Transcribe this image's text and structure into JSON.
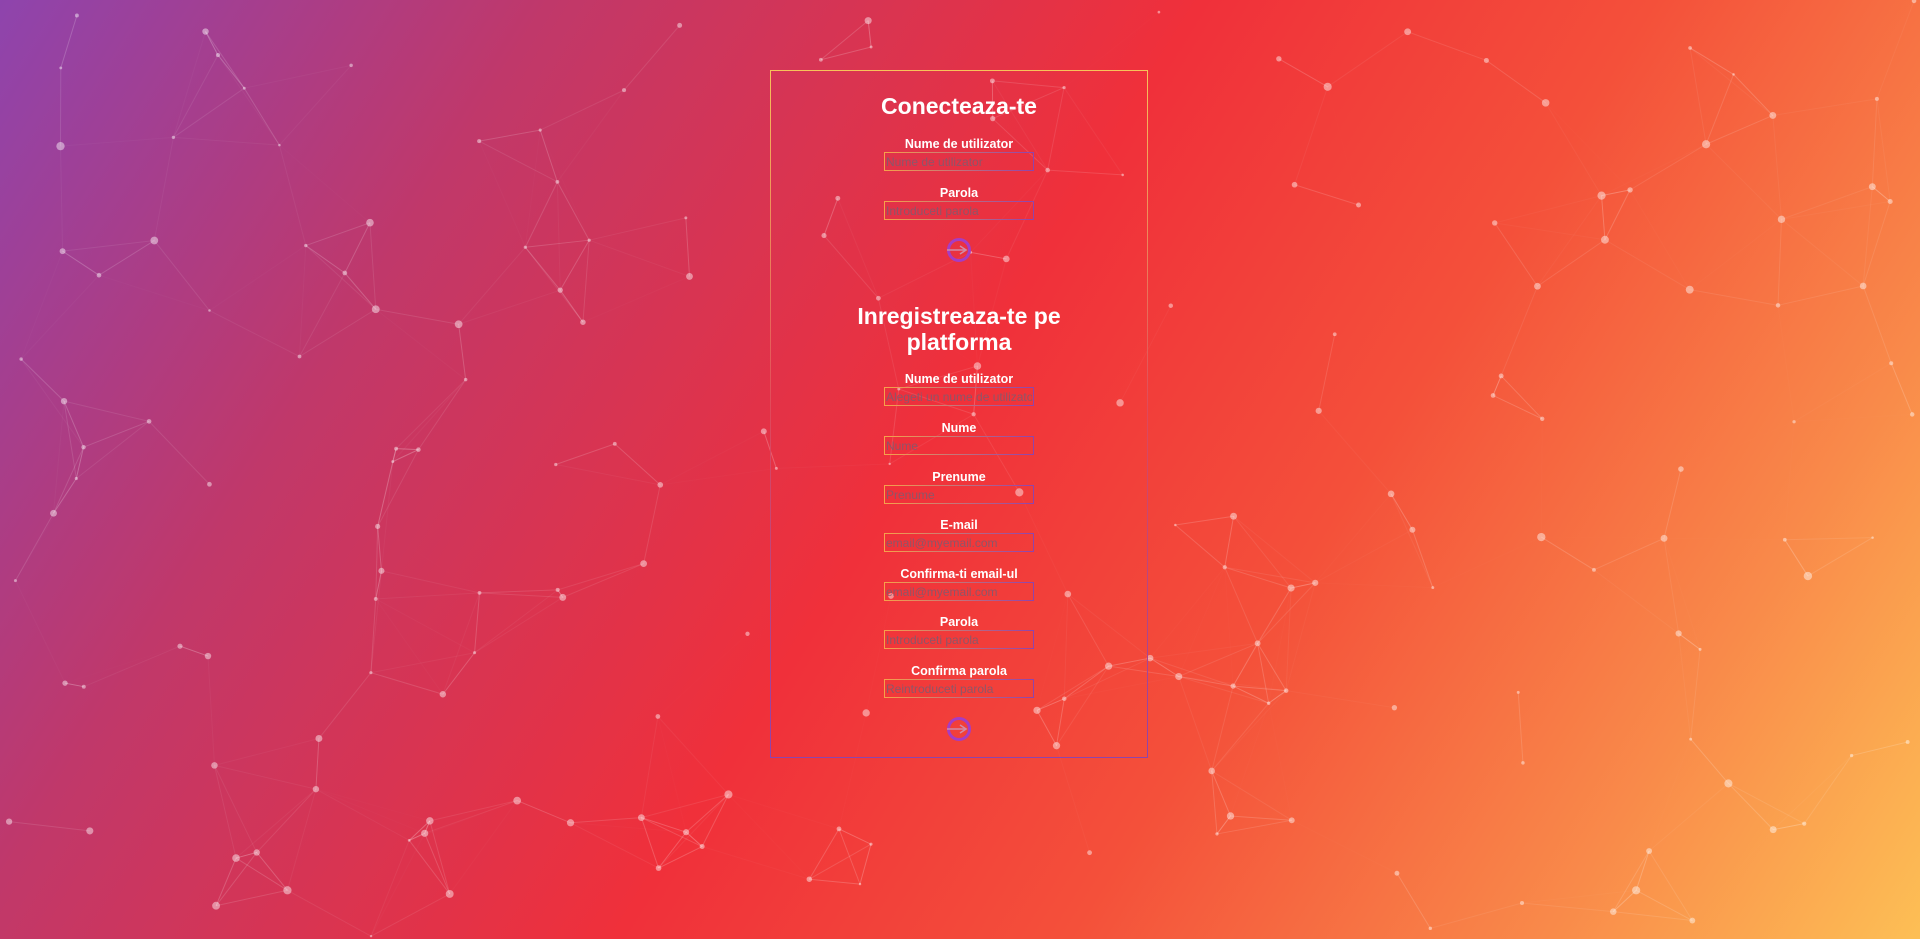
{
  "login": {
    "title": "Conecteaza-te",
    "username": {
      "label": "Nume de utilizator",
      "placeholder": "Nume de utilizator"
    },
    "password": {
      "label": "Parola",
      "placeholder": "Introduceti parola"
    }
  },
  "register": {
    "title": "Inregistreaza-te pe platforma",
    "username": {
      "label": "Nume de utilizator",
      "placeholder": "Alegeti un nume de utilizator"
    },
    "last_name": {
      "label": "Nume",
      "placeholder": "Nume"
    },
    "first_name": {
      "label": "Prenume",
      "placeholder": "Prenume"
    },
    "email": {
      "label": "E-mail",
      "placeholder": "email@myemail.com"
    },
    "email_confirm": {
      "label": "Confirma-ti email-ul",
      "placeholder": "email@myemail.com"
    },
    "password": {
      "label": "Parola",
      "placeholder": "Introduceti parola"
    },
    "password_confirm": {
      "label": "Confirma parola",
      "placeholder": "Reintroduceti parola"
    }
  },
  "icons": {
    "submit": "arrow-right-icon",
    "background": "network-constellation"
  },
  "colors": {
    "gradient_start": "#8e44ad",
    "gradient_mid": "#f0303a",
    "gradient_end": "#fdbf55",
    "button_ring": "#a63cc4"
  }
}
